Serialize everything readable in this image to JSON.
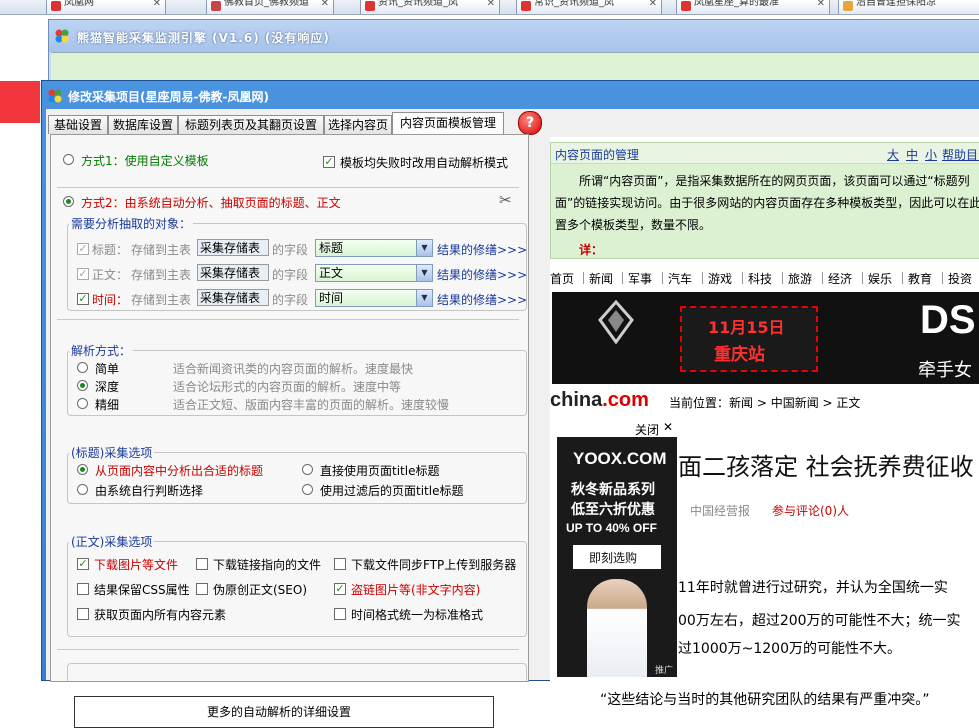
{
  "browser_tabs": [
    {
      "label": "凤凰网"
    },
    {
      "label": "佛教首页_佛教频道"
    },
    {
      "label": "资讯_资讯频道_凤"
    },
    {
      "label": "常识_资讯频道_凤"
    },
    {
      "label": "凤凰星座_算的最准"
    },
    {
      "label": "治自曾逢担保阳凉"
    }
  ],
  "outer_window": {
    "title": "熊猫智能采集监测引擎  (V1.6) (没有响应)"
  },
  "dialog": {
    "title": "修改采集项目(星座周易-佛教-凤凰网)",
    "help_glyph": "?",
    "tabs": [
      "基础设置",
      "数据库设置",
      "标题列表页及其翻页设置",
      "选择内容页",
      "内容页面模板管理"
    ],
    "method1": {
      "label": "方式1：使用自定义模板",
      "fallback_checkbox": "模板均失败时改用自动解析模式"
    },
    "method2": {
      "label": "方式2：由系统自动分析、抽取页面的标题、正文"
    },
    "targets": {
      "group_title": "需要分析抽取的对象：",
      "store_to": "存储到主表",
      "field_word": "的字段",
      "table_value": "采集存储表",
      "modify_link": "结果的修缮>>>",
      "rows": [
        {
          "name": "标题：",
          "field": "标题"
        },
        {
          "name": "正文：",
          "field": "正文"
        },
        {
          "name": "时间：",
          "field": "时间"
        }
      ]
    },
    "parse_mode": {
      "group_title": "解析方式：",
      "options": [
        {
          "label": "简单",
          "desc": "适合新闻资讯类的内容页面的解析。速度最快"
        },
        {
          "label": "深度",
          "desc": "适合论坛形式的内容页面的解析。速度中等"
        },
        {
          "label": "精细",
          "desc": "适合正文短、版面内容丰富的页面的解析。速度较慢"
        }
      ]
    },
    "title_options": {
      "group_title": "(标题)采集选项",
      "opt1": "从页面内容中分析出合适的标题",
      "opt2": "直接使用页面title标题",
      "opt3": "由系统自行判断选择",
      "opt4": "使用过滤后的页面title标题"
    },
    "body_options": {
      "group_title": "(正文)采集选项",
      "opt1": "下载图片等文件",
      "opt2": "下载链接指向的文件",
      "opt3": "下载文件同步FTP上传到服务器",
      "opt4": "结果保留CSS属性",
      "opt5": "伪原创正文(SEO)",
      "opt6": "盗链图片等(非文字内容)",
      "opt7": "获取页面内所有内容元素",
      "opt8": "时间格式统一为标准格式"
    },
    "bottom_button": "更多的自动解析的详细设置"
  },
  "help_panel": {
    "title": "内容页面的管理",
    "size_large": "大",
    "size_mid": "中",
    "size_small": "小",
    "toc": "帮助目录",
    "line1": "所谓“内容页面”，是指采集数据所在的网页页面，该页面可以通过“标题列",
    "line2": "面”的链接实现访问。由于很多网站的内容页面存在多种模板类型，因此可以在此",
    "line3": "置多个模板类型，数量不限。",
    "detail": "详："
  },
  "site_nav": [
    "首页",
    "新闻",
    "军事",
    "汽车",
    "游戏",
    "科技",
    "旅游",
    "经济",
    "娱乐",
    "教育",
    "投资"
  ],
  "banner": {
    "date_text": "11月15日",
    "city_text": "重庆站",
    "brand_text": "DS",
    "slogan_text": "牵手女"
  },
  "logo": {
    "text": "china",
    "suffix": ".com"
  },
  "breadcrumb": {
    "prefix": "当前位置：",
    "items": [
      "新闻",
      "中国新闻",
      "正文"
    ]
  },
  "ad": {
    "close_label": "关闭",
    "brand": "YOOX.COM",
    "line1": "秋冬新品系列",
    "line2": "低至六折优惠",
    "line3": "UP TO 40% OFF",
    "cta": "即刻选购",
    "tag": "推广"
  },
  "article": {
    "headline": "面二孩落定 社会抚养费征收",
    "source": "中国经营报",
    "comments": "参与评论(0)人",
    "p1": "11年时就曾进行过研究，并认为全国统一实",
    "p2": "00万左右，超过200万的可能性不大；统一实",
    "p3": "过1000万~1200万的可能性不大。",
    "p4": "“这些结论与当时的其他研究团队的结果有严重冲突。”"
  }
}
